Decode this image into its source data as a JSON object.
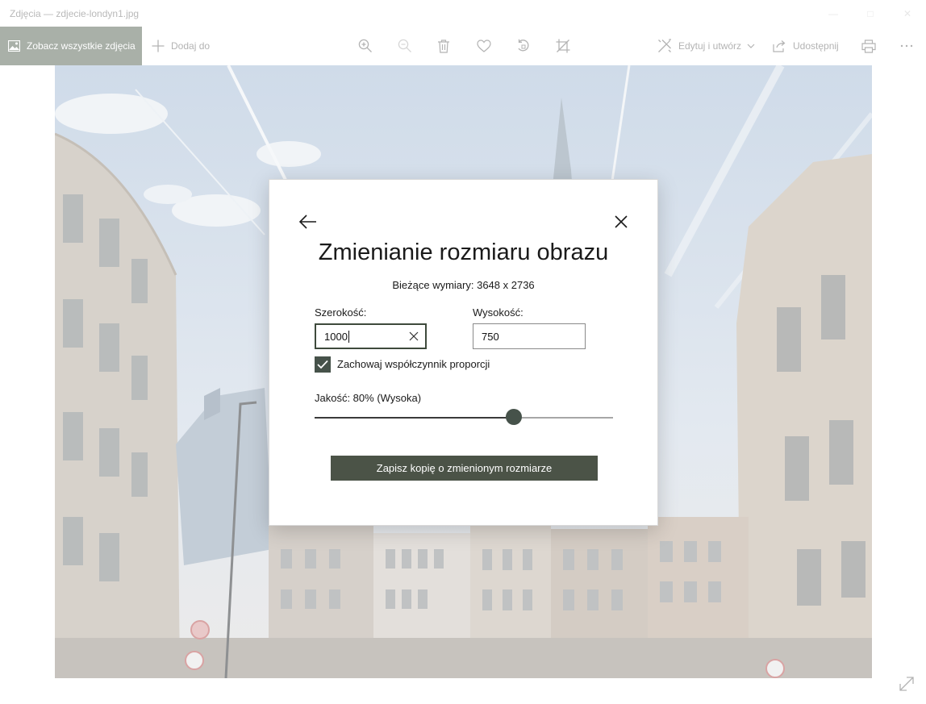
{
  "window": {
    "title": "Zdjęcia — zdjecie-londyn1.jpg"
  },
  "toolbar": {
    "see_all_label": "Zobacz wszystkie zdjęcia",
    "add_to_label": "Dodaj do",
    "edit_create_label": "Edytuj i utwórz",
    "share_label": "Udostępnij"
  },
  "dialog": {
    "title": "Zmienianie rozmiaru obrazu",
    "current_dimensions": "Bieżące wymiary: 3648 x 2736",
    "width_label": "Szerokość:",
    "width_value": "1000",
    "height_label": "Wysokość:",
    "height_value": "750",
    "keep_ratio_label": "Zachowaj współczynnik proporcji",
    "keep_ratio_checked": true,
    "quality_label": "Jakość: 80% (Wysoka)",
    "quality_value": 80,
    "save_button_label": "Zapisz kopię o zmienionym rozmiarze"
  },
  "colors": {
    "accent": "#46524a",
    "see_all_bg": "#a9b0a8",
    "toolbar_icon": "#b3b3b3"
  },
  "icons": [
    "photos-icon",
    "plus-icon",
    "zoom-in-icon",
    "zoom-out-icon",
    "trash-icon",
    "heart-icon",
    "rotate-icon",
    "crop-icon",
    "edit-create-icon",
    "chevron-down-icon",
    "share-icon",
    "print-icon",
    "more-icon",
    "back-arrow-icon",
    "close-icon",
    "clear-icon",
    "checkmark-icon",
    "expand-icon"
  ]
}
